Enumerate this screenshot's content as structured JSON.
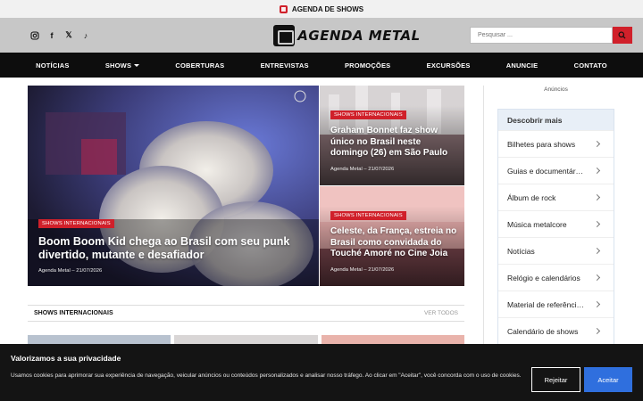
{
  "topbar": {
    "label": "AGENDA DE SHOWS",
    "icon": "calendar-icon"
  },
  "header": {
    "socials": [
      "instagram-icon",
      "facebook-icon",
      "x-icon",
      "tiktok-icon"
    ],
    "logo_text": "AGENDA METAL",
    "search_placeholder": "Pesquisar ..."
  },
  "nav": {
    "items": [
      {
        "label": "NOTÍCIAS"
      },
      {
        "label": "SHOWS"
      },
      {
        "label": "COBERTURAS"
      },
      {
        "label": "ENTREVISTAS"
      },
      {
        "label": "PROMOÇÕES"
      },
      {
        "label": "EXCURSÕES"
      },
      {
        "label": "ANUNCIE"
      },
      {
        "label": "CONTATO"
      }
    ]
  },
  "featured": {
    "main": {
      "tag": "SHOWS INTERNACIONAIS",
      "title": "Boom Boom Kid chega ao Brasil com seu punk divertido, mutante e desafiador",
      "meta": "Agenda Metal – 21/07/2026"
    },
    "side": [
      {
        "tag": "SHOWS INTERNACIONAIS",
        "title": "Graham Bonnet faz show único no Brasil neste domingo (26) em São Paulo",
        "meta": "Agenda Metal – 21/07/2026"
      },
      {
        "tag": "SHOWS INTERNACIONAIS",
        "title": "Celeste, da França, estreia no Brasil como convidada do Touché Amoré no Cine Joia",
        "meta": "Agenda Metal – 21/07/2026"
      }
    ]
  },
  "section": {
    "title": "SHOWS INTERNACIONAIS",
    "link": "VER TODOS"
  },
  "sidebar": {
    "ads_label": "Anúncios",
    "discover_title": "Descobrir mais",
    "items": [
      {
        "label": "Bilhetes para shows"
      },
      {
        "label": "Guias e documentár…"
      },
      {
        "label": "Álbum de rock"
      },
      {
        "label": "Música metalcore"
      },
      {
        "label": "Notícias"
      },
      {
        "label": "Relógio e calendários"
      },
      {
        "label": "Material de referênci…"
      },
      {
        "label": "Calendário de shows"
      }
    ]
  },
  "cookie": {
    "title": "Valorizamos a sua privacidade",
    "text": "Usamos cookies para aprimorar sua experiência de navegação, veicular anúncios ou conteúdos personalizados e analisar nosso tráfego. Ao clicar em \"Aceitar\", você concorda com o uso de cookies.",
    "reject": "Rejeitar",
    "accept": "Aceitar"
  },
  "colors": {
    "accent": "#d0202a",
    "nav_bg": "#0d0d0d",
    "accept_btn": "#2f6fde"
  }
}
